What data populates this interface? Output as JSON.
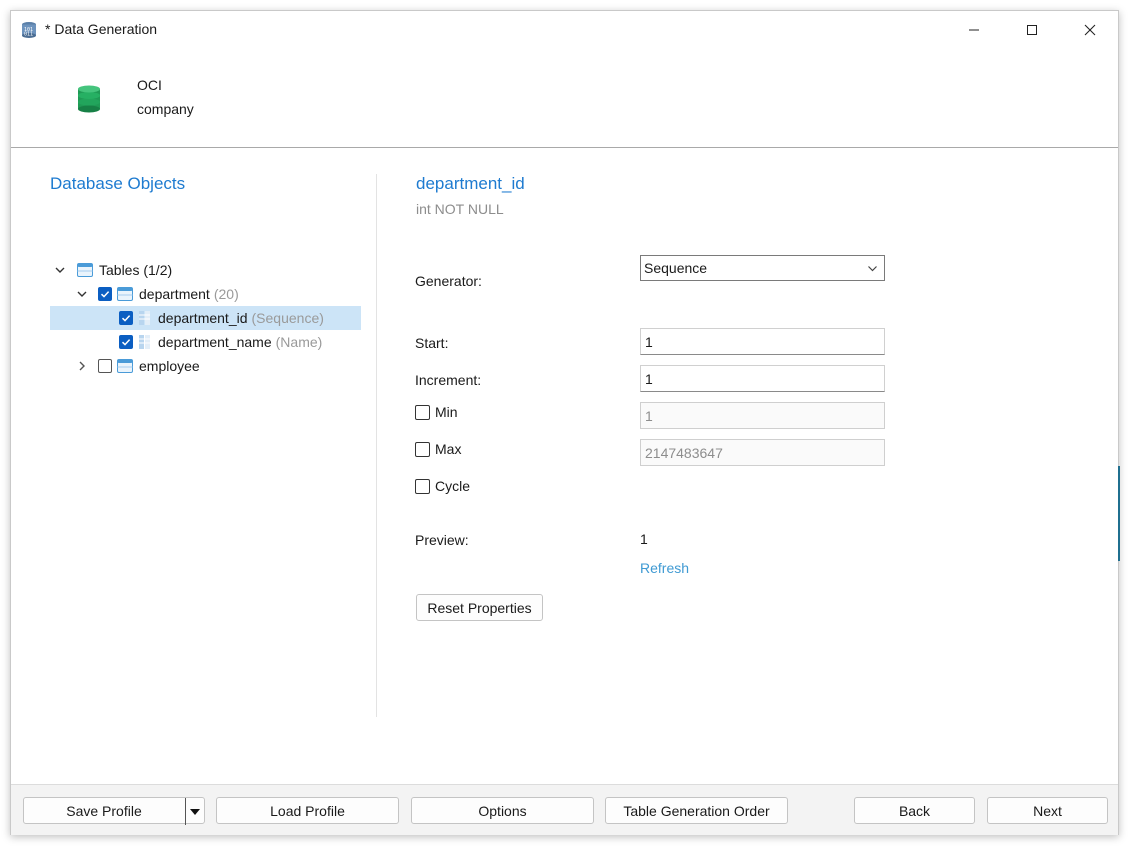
{
  "window": {
    "title": "* Data Generation"
  },
  "connection": {
    "name": "OCI",
    "database": "company",
    "icon": "database-icon"
  },
  "left": {
    "title": "Database Objects",
    "tree": {
      "tables": {
        "label": "Tables (1/2)"
      },
      "department": {
        "label": "department",
        "count": "(20)",
        "checked": true
      },
      "department_id": {
        "label": "department_id",
        "gen": "(Sequence)",
        "checked": true
      },
      "department_name": {
        "label": "department_name",
        "gen": "(Name)",
        "checked": true
      },
      "employee": {
        "label": "employee",
        "checked": false
      }
    }
  },
  "detail": {
    "column_name": "department_id",
    "column_type": "int NOT NULL",
    "generator_label": "Generator:",
    "generator_value": "Sequence",
    "start_label": "Start:",
    "start_value": "1",
    "increment_label": "Increment:",
    "increment_value": "1",
    "min_label": "Min",
    "min_value": "1",
    "max_label": "Max",
    "max_value": "2147483647",
    "cycle_label": "Cycle",
    "preview_label": "Preview:",
    "preview_value": "1",
    "refresh_label": "Refresh",
    "reset_label": "Reset Properties"
  },
  "footer": {
    "save_profile": "Save Profile",
    "load_profile": "Load Profile",
    "options": "Options",
    "table_order": "Table Generation Order",
    "back": "Back",
    "next": "Next"
  },
  "colors": {
    "accent": "#1e7bd0",
    "link": "#3f9ad3",
    "selection": "#cce4f7",
    "checkbox": "#0b5ec2"
  }
}
